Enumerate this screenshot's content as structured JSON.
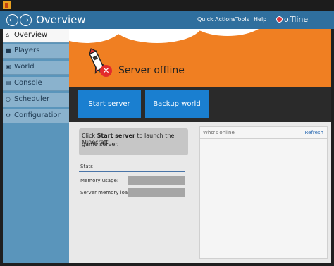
{
  "header": {
    "title": "Overview",
    "menu": [
      "Quick Actions",
      "Tools",
      "Help"
    ],
    "status": "offline"
  },
  "sidebar": {
    "items": [
      {
        "label": "Overview",
        "icon": "home-icon"
      },
      {
        "label": "Players",
        "icon": "player-icon"
      },
      {
        "label": "World",
        "icon": "world-icon"
      },
      {
        "label": "Console",
        "icon": "console-icon"
      },
      {
        "label": "Scheduler",
        "icon": "clock-icon"
      },
      {
        "label": "Configuration",
        "icon": "gear-icon"
      }
    ]
  },
  "banner": {
    "status_text": "Server offline"
  },
  "actions": {
    "start": "Start server",
    "backup": "Backup world now"
  },
  "info": {
    "pre": "Click ",
    "bold": "Start server",
    "post": " to launch the Minecraft",
    "line2": "game server."
  },
  "stats": {
    "title": "Stats",
    "memory_usage_label": "Memory usage:",
    "server_memory_label": "Server memory load:"
  },
  "online": {
    "title": "Who's online",
    "refresh": "Refresh"
  },
  "colors": {
    "header": "#2f6f9e",
    "accent_button": "#1a7fd0",
    "banner": "#f07f22",
    "status_offline": "#d9363e"
  }
}
